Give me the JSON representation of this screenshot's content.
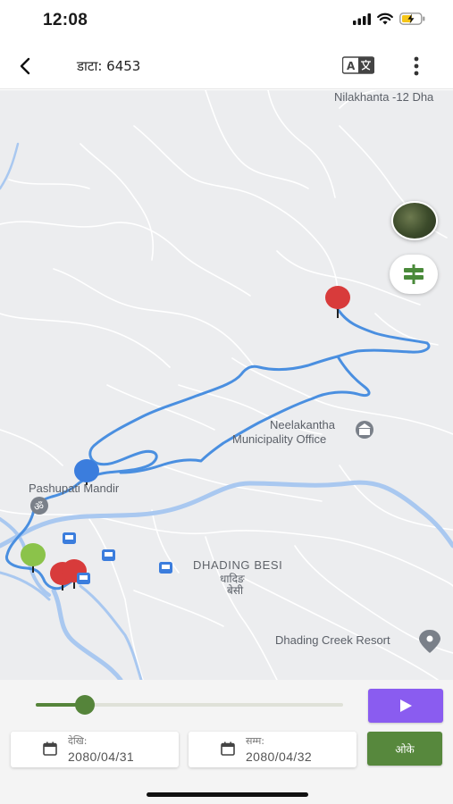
{
  "status_bar": {
    "time": "12:08"
  },
  "app_bar": {
    "title": "डाटा: 6453"
  },
  "map": {
    "labels": {
      "nilakhanta": "Nilakhanta -12 Dha",
      "neelakantha_line1": "Neelakantha",
      "neelakantha_line2": "Municipality Office",
      "pashupati": "Pashupati Mandir",
      "dhading_besi": "DHADING BESI",
      "dhading_besi_np_1": "धादिङ",
      "dhading_besi_np_2": "बेसी",
      "dhading_creek": "Dhading Creek Resort"
    }
  },
  "controls": {
    "playback_progress_percent": 16,
    "from_label": "देखि:",
    "from_date": "2080/04/31",
    "to_label": "सम्म:",
    "to_date": "2080/04/32",
    "ok_label": "ओके"
  },
  "colors": {
    "route": "#4a8fe0",
    "accent_purple": "#8a5cf0",
    "accent_green": "#57883d",
    "pin_red": "#d83b3b",
    "pin_blue": "#3b7ddd",
    "pin_green": "#8bc34a"
  }
}
